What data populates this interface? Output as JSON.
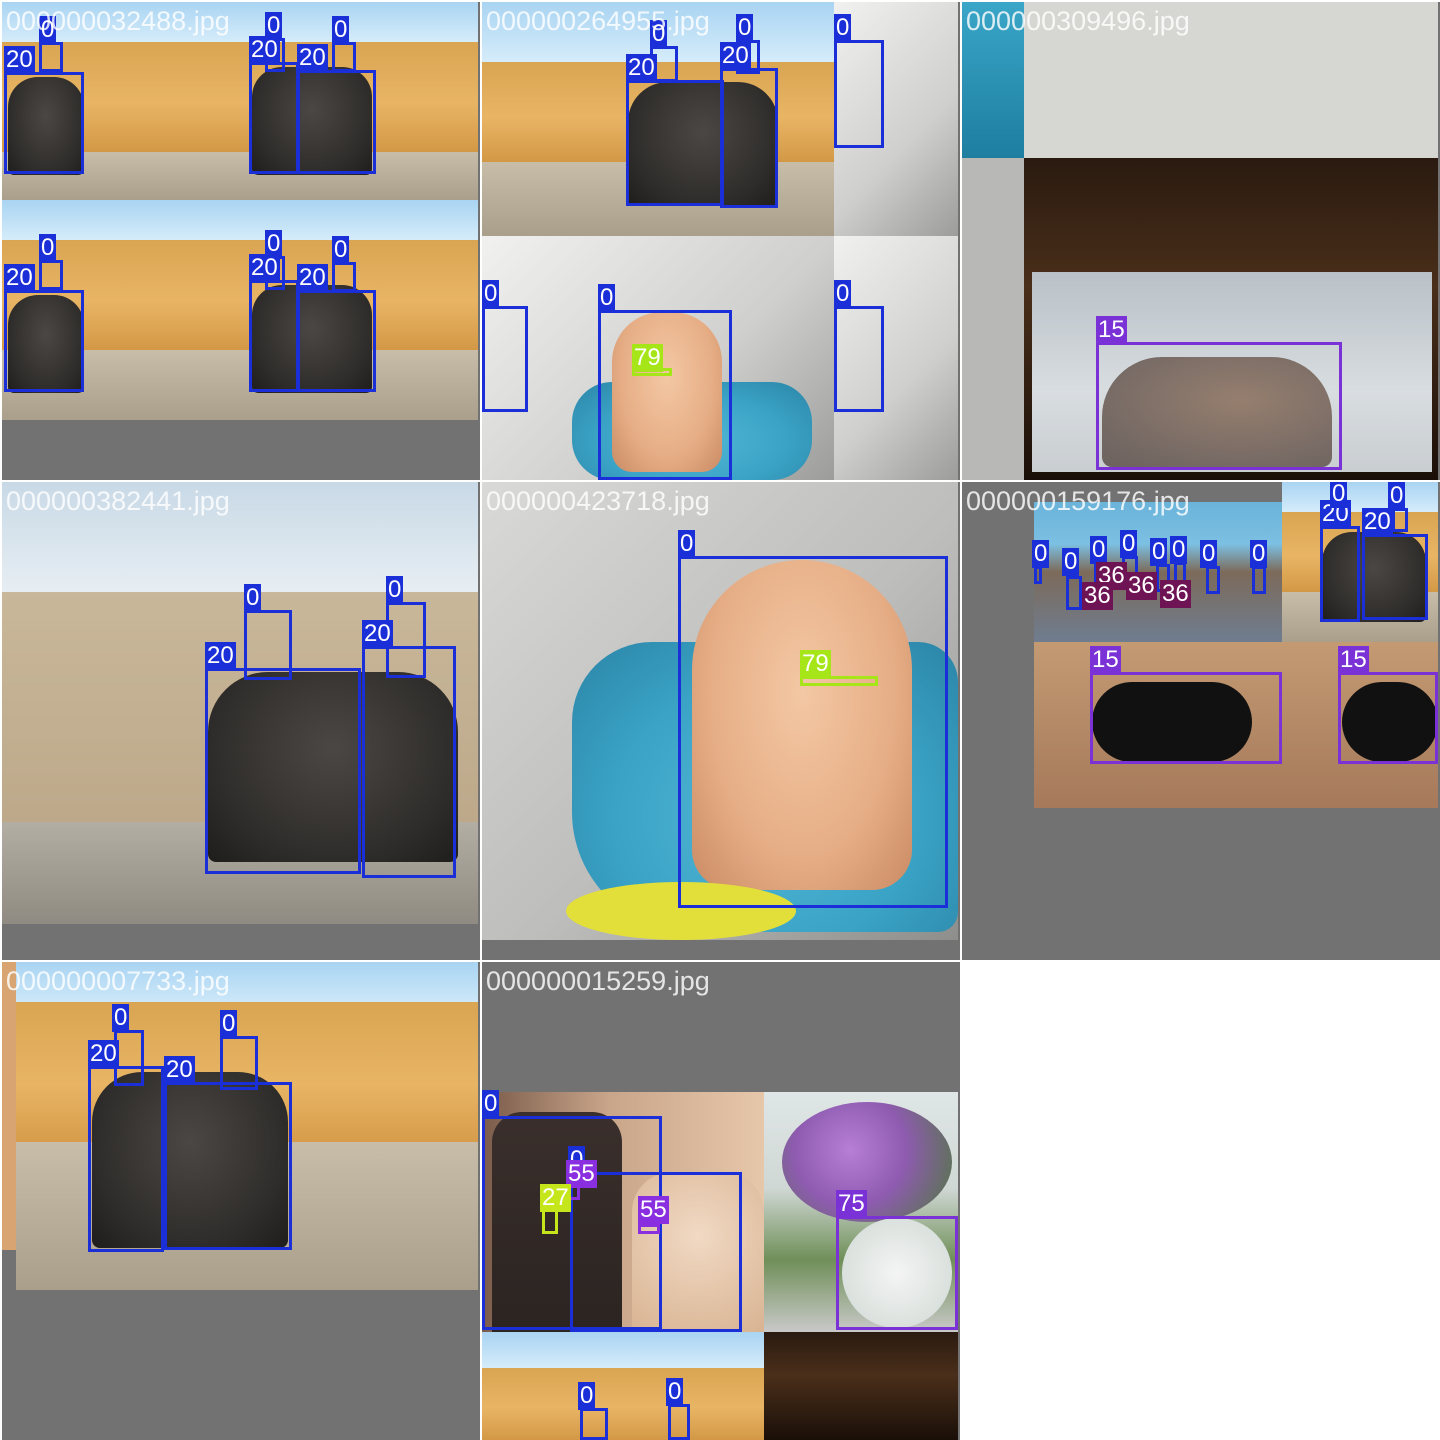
{
  "tiles": [
    {
      "filename": "000000032488.jpg"
    },
    {
      "filename": "000000264955.jpg"
    },
    {
      "filename": "000000309496.jpg"
    },
    {
      "filename": "000000382441.jpg"
    },
    {
      "filename": "000000423718.jpg"
    },
    {
      "filename": "000000159176.jpg"
    },
    {
      "filename": "000000007733.jpg"
    },
    {
      "filename": "000000015259.jpg"
    }
  ],
  "class_colors": {
    "0": "#1b2fd8",
    "15": "#7a32d6",
    "20": "#1b2fd8",
    "36": "#6e1455",
    "55": "#8a2fe0",
    "75": "#7a32d6",
    "79": "#a6e619",
    "27": "#c4e61a"
  },
  "labels": {
    "person": "0",
    "cat": "15",
    "elephant": "20",
    "skateboard": "36",
    "cake": "55",
    "vase": "75",
    "toothbrush": "79",
    "tie": "27"
  }
}
